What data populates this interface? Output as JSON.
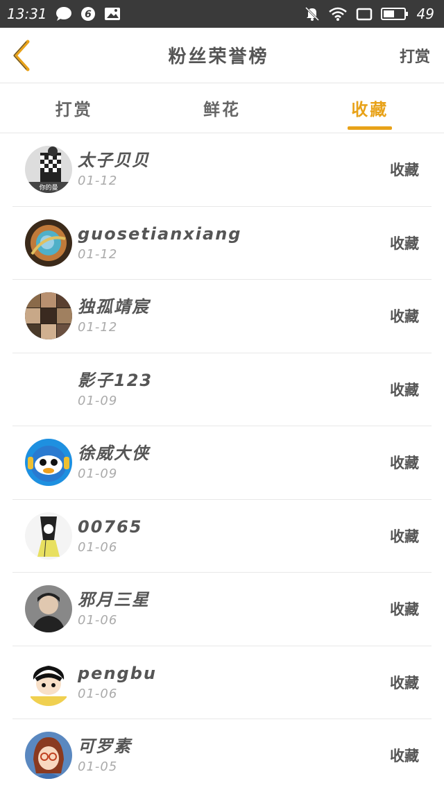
{
  "status_bar": {
    "time": "13:31",
    "battery": "49"
  },
  "header": {
    "title": "粉丝荣誉榜",
    "action_label": "打赏"
  },
  "tabs": [
    {
      "label": "打赏",
      "active": false
    },
    {
      "label": "鲜花",
      "active": false
    },
    {
      "label": "收藏",
      "active": true
    }
  ],
  "colors": {
    "accent": "#e8a219",
    "status_bar": "#3a3a3a"
  },
  "rows": [
    {
      "name": "太子贝贝",
      "date": "01-12",
      "action": "收藏",
      "avatar": "avatar-checker"
    },
    {
      "name": "guosetianxiang",
      "date": "01-12",
      "action": "收藏",
      "avatar": "avatar-swirl"
    },
    {
      "name": "独孤靖宸",
      "date": "01-12",
      "action": "收藏",
      "avatar": "avatar-collage"
    },
    {
      "name": "影子123",
      "date": "01-09",
      "action": "收藏",
      "avatar": ""
    },
    {
      "name": "徐威大侠",
      "date": "01-09",
      "action": "收藏",
      "avatar": "avatar-penguin"
    },
    {
      "name": "00765",
      "date": "01-06",
      "action": "收藏",
      "avatar": "avatar-cartoon"
    },
    {
      "name": "邪月三星",
      "date": "01-06",
      "action": "收藏",
      "avatar": "avatar-boy"
    },
    {
      "name": "pengbu",
      "date": "01-06",
      "action": "收藏",
      "avatar": "avatar-anime"
    },
    {
      "name": "可罗素",
      "date": "01-05",
      "action": "收藏",
      "avatar": "avatar-girl"
    }
  ]
}
